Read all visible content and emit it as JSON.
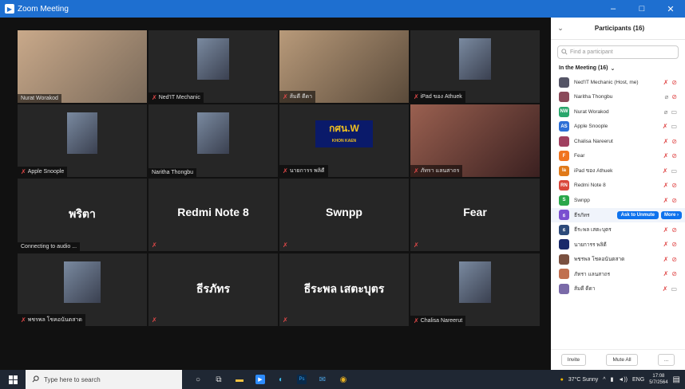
{
  "window": {
    "title": "Zoom Meeting",
    "minimize": "–",
    "maximize": "□",
    "close": "✕"
  },
  "tiles": [
    {
      "name": "Nurat Worakod",
      "muted": false,
      "active": true
    },
    {
      "name": "Ned'IT Mechanic",
      "muted": true
    },
    {
      "name": "ส้มดี ดีดา",
      "muted": true
    },
    {
      "name": "iPad ของ Athuek",
      "muted": true
    },
    {
      "name": "Apple Snoople",
      "muted": true
    },
    {
      "name": "Naritha Thongbu",
      "muted": false
    },
    {
      "name": "นายการร พลิดี",
      "muted": true
    },
    {
      "name": "ภัทรา แลนสาถร",
      "muted": true
    },
    {
      "name": "พริตา",
      "status": "Connecting to audio ...",
      "nocam": true
    },
    {
      "name": "Redmi Note 8",
      "nocam": true,
      "muted": true
    },
    {
      "name": "Swnpp",
      "nocam": true,
      "muted": true
    },
    {
      "name": "Fear",
      "nocam": true,
      "muted": true
    },
    {
      "name": "พชรพล โชคอนันตสาด",
      "muted": true
    },
    {
      "name": "ธีรภัทร",
      "nocam": true,
      "muted": true
    },
    {
      "name": "ธีระพล เสตะบุตร",
      "nocam": true,
      "muted": true
    },
    {
      "name": "Chalisa Nareerut",
      "muted": true
    }
  ],
  "panel": {
    "title": "Participants (16)",
    "search_placeholder": "Find a participant",
    "section": "In the Meeting (16)",
    "participants": [
      {
        "name": "Ned'IT Mechanic (Host, me)",
        "initials": "",
        "color": "#556",
        "mic": "off",
        "video": "off"
      },
      {
        "name": "Naritha Thongbu",
        "initials": "",
        "color": "#8a4a5a",
        "mic": "on",
        "video": "off"
      },
      {
        "name": "Nurat Worakod",
        "initials": "NW",
        "color": "#28a66b",
        "mic": "on",
        "video": "on"
      },
      {
        "name": "Apple Snoople",
        "initials": "AS",
        "color": "#2d6fd6",
        "mic": "off",
        "video": "on"
      },
      {
        "name": "Chalisa Nareerut",
        "initials": "",
        "color": "#a04060",
        "mic": "off",
        "video": "off"
      },
      {
        "name": "Fear",
        "initials": "F",
        "color": "#f07420",
        "mic": "off",
        "video": "off"
      },
      {
        "name": "iPad ของ Athuek",
        "initials": "Ia",
        "color": "#e07a1a",
        "mic": "off",
        "video": "on"
      },
      {
        "name": "Redmi Note 8",
        "initials": "RN",
        "color": "#d9473a",
        "mic": "off",
        "video": "off"
      },
      {
        "name": "Swnpp",
        "initials": "S",
        "color": "#2aa74a",
        "mic": "off",
        "video": "off"
      },
      {
        "name": "ธีรภัทร",
        "initials": "ธ",
        "color": "#7a4fd0",
        "mic": "",
        "video": ""
      },
      {
        "name": "ธีระพล เสตะบุตร",
        "initials": "ธ",
        "color": "#2d4a7a",
        "mic": "off",
        "video": "off"
      },
      {
        "name": "นายการร พลิดี",
        "initials": "",
        "color": "#1a2a6a",
        "mic": "off",
        "video": "off"
      },
      {
        "name": "พชรพล โชคอนันตสาด",
        "initials": "",
        "color": "#7a5040",
        "mic": "off",
        "video": "off"
      },
      {
        "name": "ภัทรา แลนสาถร",
        "initials": "",
        "color": "#c07050",
        "mic": "off",
        "video": "off"
      },
      {
        "name": "ส้มดี ดีดา",
        "initials": "",
        "color": "#7a6aa8",
        "mic": "off",
        "video": "on"
      }
    ],
    "ask_to_unmute": "Ask to Unmute",
    "more": "More ›",
    "invite": "Invite",
    "mute_all": "Mute All",
    "overflow": "..."
  },
  "taskbar": {
    "search_placeholder": "Type here to search",
    "weather": "37°C Sunny",
    "lang": "ENG",
    "time": "17:08",
    "date": "5/7/2564"
  }
}
